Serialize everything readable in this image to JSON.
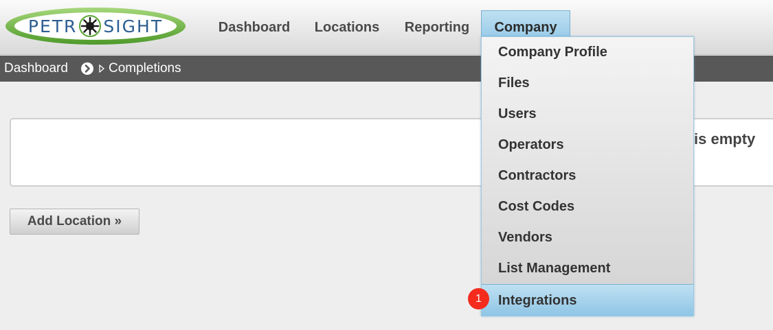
{
  "logo": {
    "left": "PETR",
    "right": "SIGHT"
  },
  "nav": {
    "dashboard": "Dashboard",
    "locations": "Locations",
    "reporting": "Reporting",
    "company": "Company"
  },
  "breadcrumb": {
    "root": "Dashboard",
    "current": "Completions"
  },
  "main": {
    "empty_message": "is empty",
    "add_location_label": "Add Location »"
  },
  "company_menu": {
    "items": [
      "Company Profile",
      "Files",
      "Users",
      "Operators",
      "Contractors",
      "Cost Codes",
      "Vendors",
      "List Management",
      "Integrations"
    ],
    "active_item": "Integrations"
  },
  "badge": {
    "count": "1"
  },
  "colors": {
    "brand_blue": "#2c5e91",
    "logo_green": "#6db33f",
    "active_blue": "#8ec5e5",
    "crumb_bar": "#585858",
    "badge_red": "#f52b1e"
  }
}
